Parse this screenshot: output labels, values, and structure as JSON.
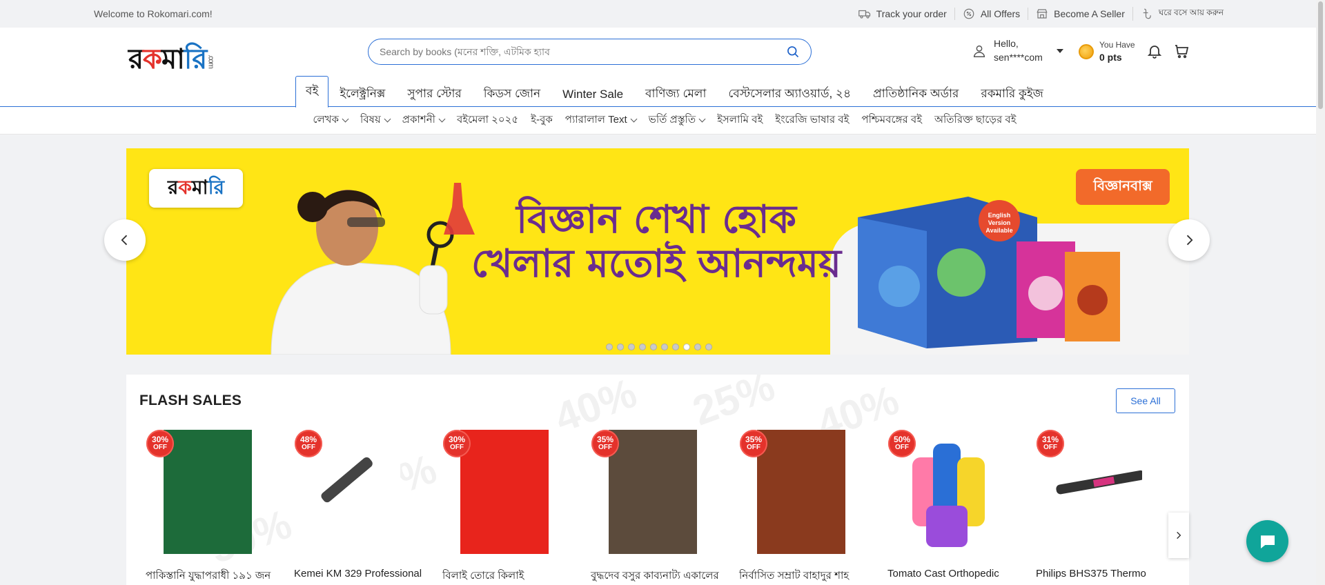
{
  "topbar": {
    "welcome": "Welcome to Rokomari.com!",
    "links": [
      "Track your order",
      "All Offers",
      "Become A Seller",
      "ঘরে বসে আয় করুন"
    ]
  },
  "header": {
    "logo_text": "রকমারি",
    "logo_suffix": ".com",
    "search_placeholder": "Search by books (মনের শক্তি, এটমিক হ্যাব",
    "user_greeting": "Hello,",
    "user_name": "sen****com",
    "points_label": "You Have",
    "points_value": "0 pts"
  },
  "nav": {
    "tabs": [
      "বই",
      "ইলেক্ট্রনিক্স",
      "সুপার স্টোর",
      "কিডস জোন",
      "Winter Sale",
      "বাণিজ্য মেলা",
      "বেস্টসেলার অ্যাওয়ার্ড, ২৪",
      "প্রাতিষ্ঠানিক অর্ডার",
      "রকমারি কুইজ"
    ],
    "active_tab": 0
  },
  "subnav": {
    "items": [
      {
        "label": "লেখক",
        "dropdown": true
      },
      {
        "label": "বিষয়",
        "dropdown": true
      },
      {
        "label": "প্রকাশনী",
        "dropdown": true
      },
      {
        "label": "বইমেলা ২০২৫",
        "dropdown": false
      },
      {
        "label": "ই-বুক",
        "dropdown": false
      },
      {
        "label": "প্যারালাল Text",
        "dropdown": true
      },
      {
        "label": "ভর্তি প্রস্তুতি",
        "dropdown": true
      },
      {
        "label": "ইসলামি বই",
        "dropdown": false
      },
      {
        "label": "ইংরেজি ভাষার বই",
        "dropdown": false
      },
      {
        "label": "পশ্চিমবঙ্গের বই",
        "dropdown": false
      },
      {
        "label": "অতিরিক্ত ছাড়ের বই",
        "dropdown": false
      }
    ]
  },
  "banner": {
    "logo_text": "রকমারি",
    "brand_text": "বিজ্ঞানবাক্স",
    "headline_line1": "বিজ্ঞান শেখা হোক",
    "headline_line2": "খেলার মতোই আনন্দময়",
    "badge_text": "English Version Available",
    "slide_count": 10,
    "active_slide": 7,
    "colors": {
      "background": "#ffe515",
      "headline": "#6a2c8f",
      "brand": "#f26a2a"
    }
  },
  "flash_sales": {
    "title": "FLASH SALES",
    "see_all": "See All",
    "products": [
      {
        "name": "পাকিস্তানি যুদ্ধাপরাধী ১৯১ জন",
        "discount": "30%",
        "off": "OFF",
        "cover_color": "#1d6b3a"
      },
      {
        "name": "Kemei KM 329 Professional",
        "discount": "48%",
        "off": "OFF",
        "cover_color": "#ffffff"
      },
      {
        "name": "বিলাই তোরে কিলাই",
        "discount": "30%",
        "off": "OFF",
        "cover_color": "#e8241c"
      },
      {
        "name": "বুদ্ধদেব বসুর কাব্যনাট্য একালের",
        "discount": "35%",
        "off": "OFF",
        "cover_color": "#5c4b3c"
      },
      {
        "name": "নির্বাসিত সম্রাট বাহাদুর শাহ",
        "discount": "35%",
        "off": "OFF",
        "cover_color": "#8a3a1e"
      },
      {
        "name": "Tomato Cast Orthopedic",
        "discount": "50%",
        "off": "OFF",
        "cover_color": "#ffffff"
      },
      {
        "name": "Philips BHS375 Thermo",
        "discount": "31%",
        "off": "OFF",
        "cover_color": "#ffffff"
      }
    ]
  }
}
